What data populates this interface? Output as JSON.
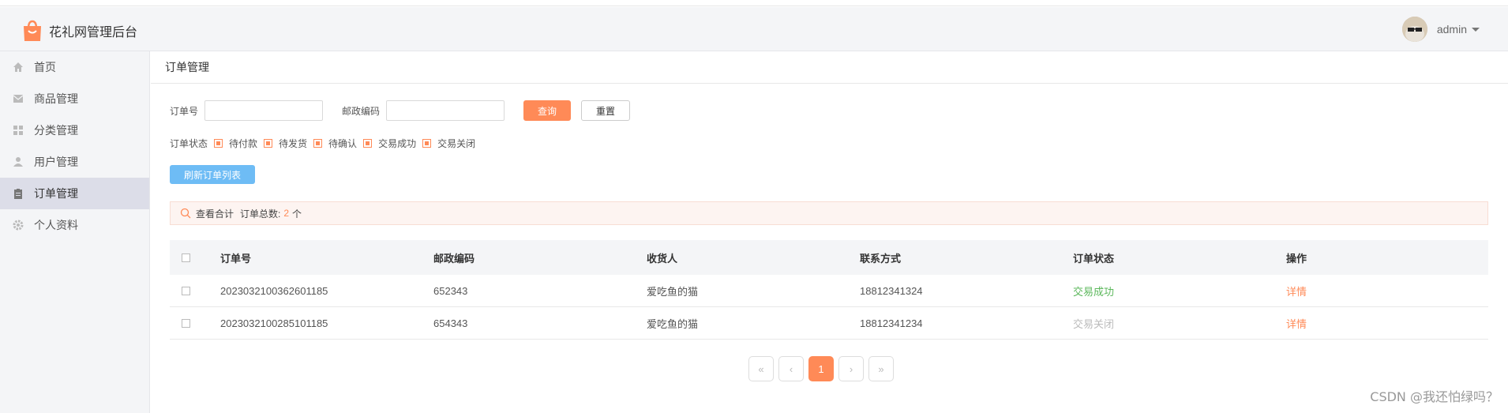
{
  "app": {
    "title": "花礼网管理后台",
    "user": "admin"
  },
  "sidebar": {
    "items": [
      {
        "label": "首页",
        "icon": "home-icon"
      },
      {
        "label": "商品管理",
        "icon": "mail-icon"
      },
      {
        "label": "分类管理",
        "icon": "grid-icon"
      },
      {
        "label": "用户管理",
        "icon": "user-icon"
      },
      {
        "label": "订单管理",
        "icon": "clipboard-icon",
        "active": true
      },
      {
        "label": "个人资料",
        "icon": "gear-icon"
      }
    ]
  },
  "breadcrumb": "订单管理",
  "search": {
    "order_no_label": "订单号",
    "order_no_value": "",
    "postcode_label": "邮政编码",
    "postcode_value": "",
    "query_button": "查询",
    "reset_button": "重置"
  },
  "status_filter": {
    "label": "订单状态",
    "options": [
      "待付款",
      "待发货",
      "待确认",
      "交易成功",
      "交易关闭"
    ]
  },
  "refresh_button": "刷新订单列表",
  "summary": {
    "title": "查看合计",
    "total_label": "订单总数:",
    "count": "2",
    "unit": "个"
  },
  "table": {
    "headers": [
      "订单号",
      "邮政编码",
      "收货人",
      "联系方式",
      "订单状态",
      "操作"
    ],
    "rows": [
      {
        "order_no": "2023032100362601185",
        "postcode": "652343",
        "receiver": "爱吃鱼的猫",
        "phone": "18812341324",
        "status": "交易成功",
        "action": "详情"
      },
      {
        "order_no": "2023032100285101185",
        "postcode": "654343",
        "receiver": "爱吃鱼的猫",
        "phone": "18812341234",
        "status": "交易关闭",
        "action": "详情"
      }
    ]
  },
  "pagination": {
    "first": "«",
    "prev": "‹",
    "current": "1",
    "next": "›",
    "last": "»"
  },
  "watermark": "CSDN @我还怕绿吗？",
  "colors": {
    "accent": "#ff8a57",
    "refresh": "#6ebcf5",
    "success": "#5cb85c",
    "closed": "#bbbbbb"
  }
}
